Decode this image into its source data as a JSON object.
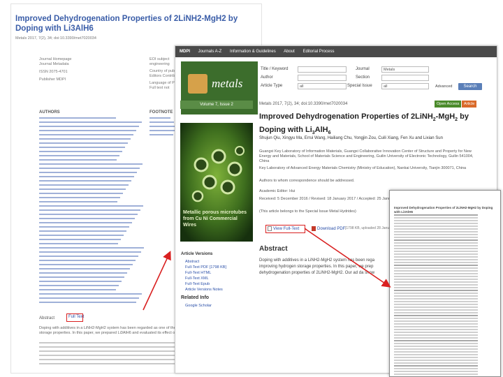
{
  "background_page": {
    "title": "Improved Dehydrogenation Properties of 2LiNH2-MgH2 by Doping with Li3AlH6",
    "meta": "Metals 2017, 7(2), 34; doi:10.3390/met7020034",
    "info_labels": [
      "Journal Homepage",
      "Journal Metadata",
      "ISSN 2075-4701",
      "Publisher MDPI"
    ],
    "right_labels": [
      "EOI subject",
      "engineering",
      "Country of pub",
      "Editors Contrib.",
      "Language of P",
      "Full text not"
    ],
    "authors_heading": "AUTHORS",
    "footnote_heading": "FOOTNOTE",
    "abstract_label": "Abstract",
    "full_text_label": "Full Text",
    "abstract_snippet": "Doping with additives in a LiNH2-MgH2 system has been regarded as one of the most effective methods of improving hydrogen storage properties. In this paper, we prepared Li3AlH6 and evaluated its effect on the dehydrogenation properties of 2LiNH2-MgH2."
  },
  "mdpi": {
    "nav": [
      "MDPI",
      "Journals A-Z",
      "Information & Guidelines",
      "About",
      "Editorial Process"
    ],
    "journal_logo": "metals",
    "search": {
      "title_label": "Title / Keyword",
      "author_label": "Author",
      "article_type_label": "Article Type",
      "article_type_value": "all",
      "journal_label": "Journal",
      "journal_value": "Metals",
      "section_label": "Section",
      "special_issue_label": "Special Issue",
      "special_issue_value": "all",
      "advanced_label": "Advanced",
      "search_button": "Search"
    },
    "issue_label": "Volume 7, Issue 2",
    "cover_caption": "Metallic porous microtubes from Cu Ni Commercial Wires",
    "article": {
      "citation": "Metals 2017, 7(2), 34; doi:10.3390/met7020034",
      "badge_open_access": "Open Access",
      "badge_article": "Article",
      "title_line1": "Improved Dehydrogenation Properties of 2LiNH",
      "title_sub1": "2",
      "title_mid": "-MgH",
      "title_sub2": "2",
      "title_end": " by",
      "title_line2": "Doping with Li",
      "title_sub3": "3",
      "title_line2b": "AlH",
      "title_sub4": "6",
      "authors": "Shujun Qiu, Xingyu Ma, Errui Wang, Hailiang Chu, Yongjin Zou, Cuili Xiang, Fen Xu and Lixian Sun",
      "affiliation1": "Guangxi Key Laboratory of Information Materials, Guangxi Collaborative Innovation Center of Structure and Property for New Energy and Materials, School of Materials Science and Engineering, Guilin University of Electronic Technology, Guilin 541004, China",
      "affiliation2": "Key Laboratory of Advanced Energy Materials Chemistry (Ministry of Education), Nankai University, Tianjin 300071, China",
      "correspondence": "Authors to whom correspondence should be addressed.",
      "academic_editor": "Academic Editor: Hui",
      "dates": "Received: 5 December 2016 / Revised: 18 January 2017 / Accepted: 25 January 2017 / Published: 28 January 2017",
      "belongs_to": "(This article belongs to the Special Issue Metal Hydrides)",
      "view_full_text": "View Full-Text",
      "download_pdf": "Download PDF",
      "pdf_meta": "[1798 KB, uploaded 28 January 2017]",
      "abstract_heading": "Abstract",
      "abstract_text1": "Doping with additives in a LiNH2-MgH2 system has been rega",
      "abstract_text2": "improving hydrogen storage properties. In this paper, we prep",
      "abstract_text3": "dehydrogenation properties of 2LiNH2-MgH2. Our ad da show"
    },
    "sidebar": {
      "heading": "Article Versions",
      "items": [
        "Abstract",
        "Full-Text PDF [1798 KB]",
        "Full-Text HTML",
        "Full-Text XML",
        "Full-Text Epub",
        "Article Versions Notes"
      ],
      "related_heading": "Related Info",
      "related_item": "Google Scholar"
    }
  },
  "preview": {
    "title": "Improved Dehydrogenation Properties of 2LiNH2-MgH2 by Doping with Li3AlH6",
    "colors": {
      "arrow": "#d92020"
    }
  }
}
